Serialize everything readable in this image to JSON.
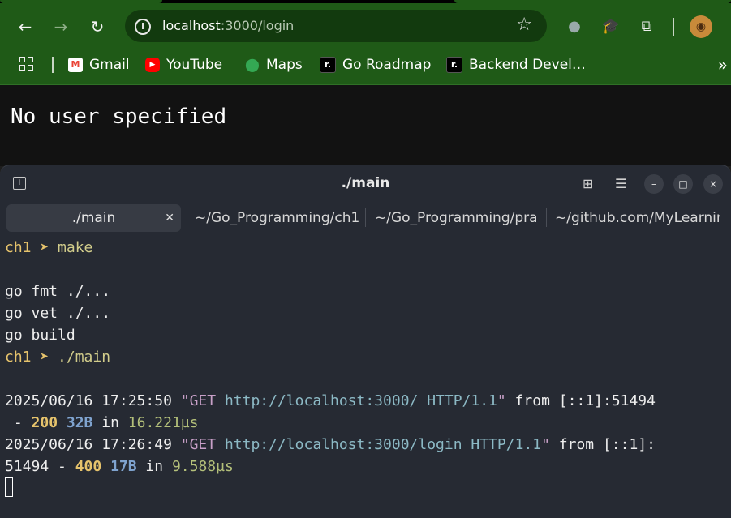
{
  "browser": {
    "url_host": "localhost",
    "url_rest": ":3000/login",
    "bookmarks": [
      {
        "label": "Gmail",
        "icon": "gmail-icon",
        "color": "#ea4335"
      },
      {
        "label": "YouTube",
        "icon": "youtube-icon",
        "color": "#ff0000"
      },
      {
        "label": "Maps",
        "icon": "maps-icon",
        "color": "#34a853"
      },
      {
        "label": "Go Roadmap",
        "icon": "roadmap-icon",
        "color": "#000000"
      },
      {
        "label": "Backend Devel…",
        "icon": "roadmap-icon",
        "color": "#000000"
      }
    ]
  },
  "page": {
    "message": "No user specified"
  },
  "terminal": {
    "title": "./main",
    "tabs": [
      {
        "label": "./main"
      },
      {
        "label": "~/Go_Programming/ch1"
      },
      {
        "label": "~/Go_Programming/prac"
      },
      {
        "label": "~/github.com/MyLearnin"
      }
    ],
    "lines": {
      "p1_dir": "ch1",
      "p1_arrow": "➤",
      "p1_cmd": "make",
      "out1": "go fmt ./...",
      "out2": "go vet ./...",
      "out3": "go build",
      "p2_dir": "ch1",
      "p2_arrow": "➤",
      "p2_cmd": "./main",
      "log1_ts": "2025/06/16 17:25:50",
      "log1_q1": "\"",
      "log1_method": "GET",
      "log1_url": "http://localhost:3000/ HTTP/1.1",
      "log1_q2": "\"",
      "log1_from": "from [::1]:51494",
      "log1_dash": " - ",
      "log1_status": "200",
      "log1_size": "32B",
      "log1_in": "in",
      "log1_dur": "16.221µs",
      "log2_ts": "2025/06/16 17:26:49",
      "log2_q1": "\"",
      "log2_method": "GET",
      "log2_url": "http://localhost:3000/login HTTP/1.1",
      "log2_q2": "\"",
      "log2_from": "from [::1]:",
      "log2_port": "51494 - ",
      "log2_status": "400",
      "log2_size": "17B",
      "log2_in": "in",
      "log2_dur": "9.588µs"
    }
  }
}
